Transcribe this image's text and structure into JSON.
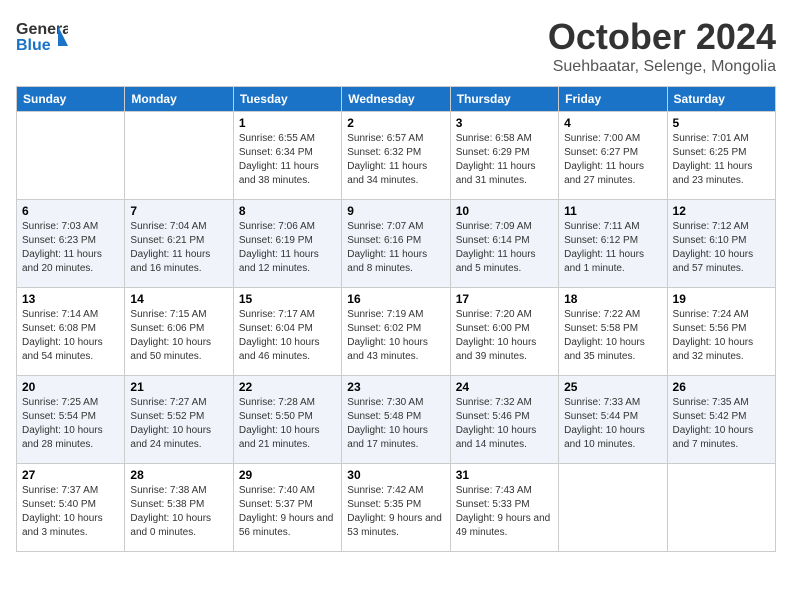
{
  "header": {
    "logo_line1": "General",
    "logo_line2": "Blue",
    "month": "October 2024",
    "location": "Suehbaatar, Selenge, Mongolia"
  },
  "weekdays": [
    "Sunday",
    "Monday",
    "Tuesday",
    "Wednesday",
    "Thursday",
    "Friday",
    "Saturday"
  ],
  "weeks": [
    [
      {
        "day": "",
        "sunrise": "",
        "sunset": "",
        "daylight": ""
      },
      {
        "day": "",
        "sunrise": "",
        "sunset": "",
        "daylight": ""
      },
      {
        "day": "1",
        "sunrise": "Sunrise: 6:55 AM",
        "sunset": "Sunset: 6:34 PM",
        "daylight": "Daylight: 11 hours and 38 minutes."
      },
      {
        "day": "2",
        "sunrise": "Sunrise: 6:57 AM",
        "sunset": "Sunset: 6:32 PM",
        "daylight": "Daylight: 11 hours and 34 minutes."
      },
      {
        "day": "3",
        "sunrise": "Sunrise: 6:58 AM",
        "sunset": "Sunset: 6:29 PM",
        "daylight": "Daylight: 11 hours and 31 minutes."
      },
      {
        "day": "4",
        "sunrise": "Sunrise: 7:00 AM",
        "sunset": "Sunset: 6:27 PM",
        "daylight": "Daylight: 11 hours and 27 minutes."
      },
      {
        "day": "5",
        "sunrise": "Sunrise: 7:01 AM",
        "sunset": "Sunset: 6:25 PM",
        "daylight": "Daylight: 11 hours and 23 minutes."
      }
    ],
    [
      {
        "day": "6",
        "sunrise": "Sunrise: 7:03 AM",
        "sunset": "Sunset: 6:23 PM",
        "daylight": "Daylight: 11 hours and 20 minutes."
      },
      {
        "day": "7",
        "sunrise": "Sunrise: 7:04 AM",
        "sunset": "Sunset: 6:21 PM",
        "daylight": "Daylight: 11 hours and 16 minutes."
      },
      {
        "day": "8",
        "sunrise": "Sunrise: 7:06 AM",
        "sunset": "Sunset: 6:19 PM",
        "daylight": "Daylight: 11 hours and 12 minutes."
      },
      {
        "day": "9",
        "sunrise": "Sunrise: 7:07 AM",
        "sunset": "Sunset: 6:16 PM",
        "daylight": "Daylight: 11 hours and 8 minutes."
      },
      {
        "day": "10",
        "sunrise": "Sunrise: 7:09 AM",
        "sunset": "Sunset: 6:14 PM",
        "daylight": "Daylight: 11 hours and 5 minutes."
      },
      {
        "day": "11",
        "sunrise": "Sunrise: 7:11 AM",
        "sunset": "Sunset: 6:12 PM",
        "daylight": "Daylight: 11 hours and 1 minute."
      },
      {
        "day": "12",
        "sunrise": "Sunrise: 7:12 AM",
        "sunset": "Sunset: 6:10 PM",
        "daylight": "Daylight: 10 hours and 57 minutes."
      }
    ],
    [
      {
        "day": "13",
        "sunrise": "Sunrise: 7:14 AM",
        "sunset": "Sunset: 6:08 PM",
        "daylight": "Daylight: 10 hours and 54 minutes."
      },
      {
        "day": "14",
        "sunrise": "Sunrise: 7:15 AM",
        "sunset": "Sunset: 6:06 PM",
        "daylight": "Daylight: 10 hours and 50 minutes."
      },
      {
        "day": "15",
        "sunrise": "Sunrise: 7:17 AM",
        "sunset": "Sunset: 6:04 PM",
        "daylight": "Daylight: 10 hours and 46 minutes."
      },
      {
        "day": "16",
        "sunrise": "Sunrise: 7:19 AM",
        "sunset": "Sunset: 6:02 PM",
        "daylight": "Daylight: 10 hours and 43 minutes."
      },
      {
        "day": "17",
        "sunrise": "Sunrise: 7:20 AM",
        "sunset": "Sunset: 6:00 PM",
        "daylight": "Daylight: 10 hours and 39 minutes."
      },
      {
        "day": "18",
        "sunrise": "Sunrise: 7:22 AM",
        "sunset": "Sunset: 5:58 PM",
        "daylight": "Daylight: 10 hours and 35 minutes."
      },
      {
        "day": "19",
        "sunrise": "Sunrise: 7:24 AM",
        "sunset": "Sunset: 5:56 PM",
        "daylight": "Daylight: 10 hours and 32 minutes."
      }
    ],
    [
      {
        "day": "20",
        "sunrise": "Sunrise: 7:25 AM",
        "sunset": "Sunset: 5:54 PM",
        "daylight": "Daylight: 10 hours and 28 minutes."
      },
      {
        "day": "21",
        "sunrise": "Sunrise: 7:27 AM",
        "sunset": "Sunset: 5:52 PM",
        "daylight": "Daylight: 10 hours and 24 minutes."
      },
      {
        "day": "22",
        "sunrise": "Sunrise: 7:28 AM",
        "sunset": "Sunset: 5:50 PM",
        "daylight": "Daylight: 10 hours and 21 minutes."
      },
      {
        "day": "23",
        "sunrise": "Sunrise: 7:30 AM",
        "sunset": "Sunset: 5:48 PM",
        "daylight": "Daylight: 10 hours and 17 minutes."
      },
      {
        "day": "24",
        "sunrise": "Sunrise: 7:32 AM",
        "sunset": "Sunset: 5:46 PM",
        "daylight": "Daylight: 10 hours and 14 minutes."
      },
      {
        "day": "25",
        "sunrise": "Sunrise: 7:33 AM",
        "sunset": "Sunset: 5:44 PM",
        "daylight": "Daylight: 10 hours and 10 minutes."
      },
      {
        "day": "26",
        "sunrise": "Sunrise: 7:35 AM",
        "sunset": "Sunset: 5:42 PM",
        "daylight": "Daylight: 10 hours and 7 minutes."
      }
    ],
    [
      {
        "day": "27",
        "sunrise": "Sunrise: 7:37 AM",
        "sunset": "Sunset: 5:40 PM",
        "daylight": "Daylight: 10 hours and 3 minutes."
      },
      {
        "day": "28",
        "sunrise": "Sunrise: 7:38 AM",
        "sunset": "Sunset: 5:38 PM",
        "daylight": "Daylight: 10 hours and 0 minutes."
      },
      {
        "day": "29",
        "sunrise": "Sunrise: 7:40 AM",
        "sunset": "Sunset: 5:37 PM",
        "daylight": "Daylight: 9 hours and 56 minutes."
      },
      {
        "day": "30",
        "sunrise": "Sunrise: 7:42 AM",
        "sunset": "Sunset: 5:35 PM",
        "daylight": "Daylight: 9 hours and 53 minutes."
      },
      {
        "day": "31",
        "sunrise": "Sunrise: 7:43 AM",
        "sunset": "Sunset: 5:33 PM",
        "daylight": "Daylight: 9 hours and 49 minutes."
      },
      {
        "day": "",
        "sunrise": "",
        "sunset": "",
        "daylight": ""
      },
      {
        "day": "",
        "sunrise": "",
        "sunset": "",
        "daylight": ""
      }
    ]
  ]
}
